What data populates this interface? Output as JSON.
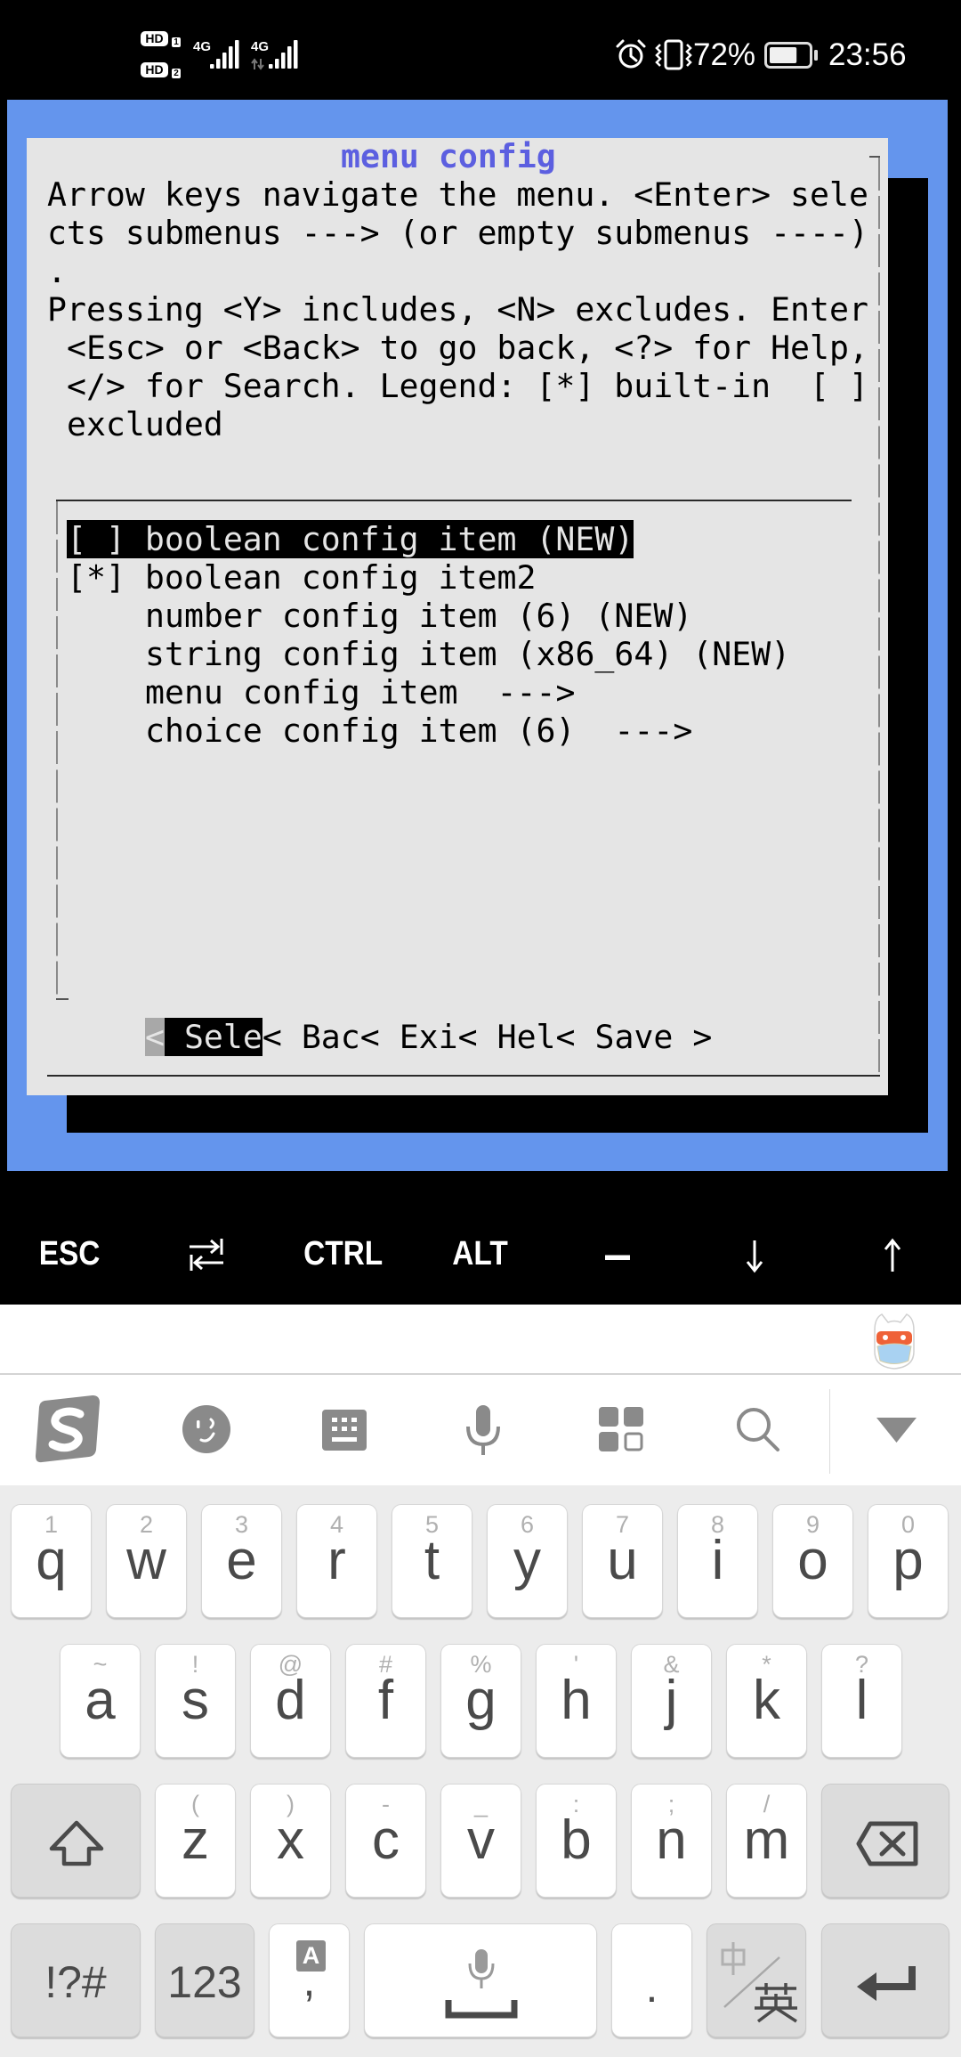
{
  "status_bar": {
    "sim_badges": [
      {
        "label": "HD",
        "slot": "1"
      },
      {
        "label": "HD",
        "slot": "2"
      }
    ],
    "networks": [
      {
        "type": "4G",
        "signal_bars": 5
      },
      {
        "type": "4G",
        "signal_bars": 5,
        "data_activity": true
      }
    ],
    "icons": [
      "alarm-icon",
      "vibrate-icon",
      "battery-icon"
    ],
    "battery_percent_text": "72%",
    "battery_level": 0.72,
    "time": "23:56"
  },
  "terminal": {
    "colors": {
      "background": "#6495ed",
      "dialog": "#e5e5e5",
      "title": "#5c5fe0",
      "shadow": "#000000",
      "highlight_bg": "#000000",
      "highlight_fg": "#e5e5e5"
    },
    "dialog": {
      "title": "menu config",
      "help_lines": [
        "Arrow keys navigate the menu. <Enter> sele",
        "cts submenus ---> (or empty submenus ----)",
        ".",
        "Pressing <Y> includes, <N> excludes. Enter",
        " <Esc> or <Back> to go back, <?> for Help,",
        " </> for Search. Legend: [*] built-in  [ ]",
        " excluded"
      ],
      "menu_items": [
        {
          "prefix": "[ ]",
          "label": "boolean config item (NEW)",
          "selected": true
        },
        {
          "prefix": "[*]",
          "label": "boolean config item2",
          "selected": false
        },
        {
          "prefix": "",
          "label": "number config item (6) (NEW)",
          "selected": false
        },
        {
          "prefix": "",
          "label": "string config item (x86_64) (NEW)",
          "selected": false
        },
        {
          "prefix": "",
          "label": "menu config item  --->",
          "selected": false
        },
        {
          "prefix": "",
          "label": "choice config item (6)  --->",
          "selected": false
        }
      ],
      "buttons": [
        {
          "open": "<",
          "label": " Sele",
          "selected": true
        },
        {
          "open": "<",
          "label": " Bac"
        },
        {
          "open": "<",
          "label": " Exi"
        },
        {
          "open": "<",
          "label": " Hel"
        },
        {
          "open": "<",
          "label": " Save ",
          "close": ">"
        }
      ]
    }
  },
  "extra_keys": [
    {
      "label": "ESC"
    },
    {
      "icon": "tab-swap-icon"
    },
    {
      "label": "CTRL"
    },
    {
      "label": "ALT"
    },
    {
      "label": "―"
    },
    {
      "icon": "arrow-down-icon"
    },
    {
      "icon": "arrow-up-icon"
    }
  ],
  "ime": {
    "mascot": "mascot-icon",
    "toolbar": [
      "sogou-logo-icon",
      "emoji-icon",
      "keyboard-layout-icon",
      "microphone-icon",
      "apps-grid-icon",
      "search-icon",
      "collapse-keyboard-icon"
    ],
    "keyboard": {
      "row1": [
        {
          "key": "q",
          "hint": "1"
        },
        {
          "key": "w",
          "hint": "2"
        },
        {
          "key": "e",
          "hint": "3"
        },
        {
          "key": "r",
          "hint": "4"
        },
        {
          "key": "t",
          "hint": "5"
        },
        {
          "key": "y",
          "hint": "6"
        },
        {
          "key": "u",
          "hint": "7"
        },
        {
          "key": "i",
          "hint": "8"
        },
        {
          "key": "o",
          "hint": "9"
        },
        {
          "key": "p",
          "hint": "0"
        }
      ],
      "row2": [
        {
          "key": "a",
          "hint": "~"
        },
        {
          "key": "s",
          "hint": "!"
        },
        {
          "key": "d",
          "hint": "@"
        },
        {
          "key": "f",
          "hint": "#"
        },
        {
          "key": "g",
          "hint": "%"
        },
        {
          "key": "h",
          "hint": "'"
        },
        {
          "key": "j",
          "hint": "&"
        },
        {
          "key": "k",
          "hint": "*"
        },
        {
          "key": "l",
          "hint": "?"
        }
      ],
      "row3": [
        {
          "key": "z",
          "hint": "("
        },
        {
          "key": "x",
          "hint": ")"
        },
        {
          "key": "c",
          "hint": "-"
        },
        {
          "key": "v",
          "hint": "_"
        },
        {
          "key": "b",
          "hint": ":"
        },
        {
          "key": "n",
          "hint": ";"
        },
        {
          "key": "m",
          "hint": "/"
        }
      ],
      "symbols_label": "!?#",
      "numbers_label": "123",
      "comma": ",",
      "comma_badge": "A",
      "period": ".",
      "lang_top": "中",
      "lang_bottom": "英"
    }
  }
}
